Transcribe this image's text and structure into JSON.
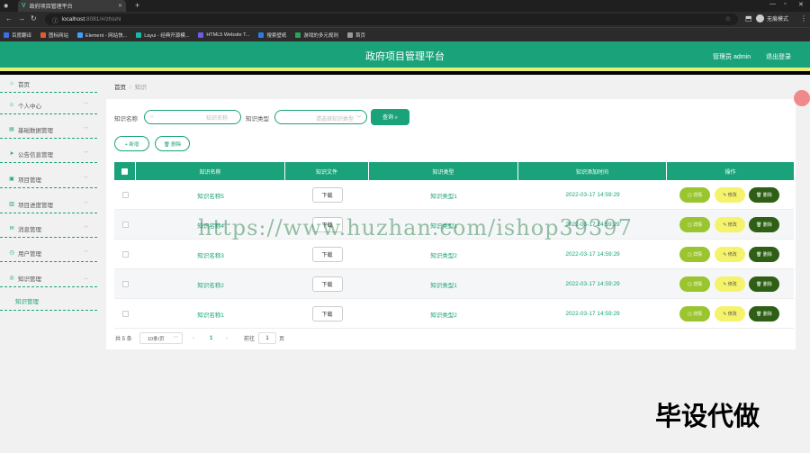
{
  "browser": {
    "tab_title": "政府项目管理平台",
    "url_host": "localhost",
    "url_rest": ":8081/#/zhishi",
    "profile_label": "无痕模式",
    "bookmarks": [
      {
        "label": "百度翻译",
        "color": "#3b6ee8"
      },
      {
        "label": "图标网站",
        "color": "#e65a2b"
      },
      {
        "label": "Element - 网站快...",
        "color": "#409eff"
      },
      {
        "label": "Layui - 经典开源模...",
        "color": "#16baaa"
      },
      {
        "label": "HTML5 Website T...",
        "color": "#6c5ce7"
      },
      {
        "label": "搜索壁纸",
        "color": "#2d7be5"
      },
      {
        "label": "游戏的多元规则",
        "color": "#26a65b"
      },
      {
        "label": "首页",
        "color": "#999999"
      }
    ]
  },
  "header": {
    "title": "政府项目管理平台",
    "user": "管理员 admin",
    "logout": "退出登录"
  },
  "sidebar": {
    "items": [
      {
        "label": "首页",
        "icon": "home-icon",
        "glyph": "⌂"
      },
      {
        "label": "个人中心",
        "icon": "user-icon",
        "glyph": "☺"
      },
      {
        "label": "基础数据管理",
        "icon": "data-icon",
        "glyph": "▤"
      },
      {
        "label": "公告信息管理",
        "icon": "send-icon",
        "glyph": "➤"
      },
      {
        "label": "项目管理",
        "icon": "project-icon",
        "glyph": "▣"
      },
      {
        "label": "项目进度管理",
        "icon": "progress-icon",
        "glyph": "▥"
      },
      {
        "label": "消息管理",
        "icon": "message-icon",
        "glyph": "✉"
      },
      {
        "label": "用户管理",
        "icon": "users-icon",
        "glyph": "◷"
      },
      {
        "label": "知识管理",
        "icon": "knowledge-icon",
        "glyph": "◎"
      }
    ],
    "sub_item": "知识管理"
  },
  "breadcrumb": {
    "home": "首页",
    "sep": "/",
    "current": "知识"
  },
  "filters": {
    "name_label": "知识名称",
    "name_placeholder": "知识名称",
    "type_label": "知识类型",
    "type_placeholder": "请选择知识类型",
    "query_button": "查询 ⌕"
  },
  "actions": {
    "add": "+ 新增",
    "delete": "🗑 删除"
  },
  "table": {
    "columns": [
      "知识名称",
      "知识文件",
      "知识类型",
      "知识添加时间",
      "操作"
    ],
    "download_label": "下载",
    "op_detail": "◫ 详情",
    "op_edit": "✎ 修改",
    "op_delete": "🗑 删除",
    "rows": [
      {
        "name": "知识名称5",
        "type": "知识类型1",
        "time": "2022-03-17 14:59:29"
      },
      {
        "name": "知识名称4",
        "type": "知识类型1",
        "time": "2022-03-17 14:59:29"
      },
      {
        "name": "知识名称3",
        "type": "知识类型2",
        "time": "2022-03-17 14:59:29"
      },
      {
        "name": "知识名称2",
        "type": "知识类型1",
        "time": "2022-03-17 14:59:29"
      },
      {
        "name": "知识名称1",
        "type": "知识类型2",
        "time": "2022-03-17 14:59:29"
      }
    ]
  },
  "pagination": {
    "total": "共 5 条",
    "page_size": "10条/页",
    "prev": "‹",
    "page": "1",
    "next": "›",
    "goto_label": "前往",
    "goto_value": "1",
    "page_unit": "页"
  },
  "watermark": "https://www.huzhan.com/ishop39397",
  "corner_text": "毕设代做"
}
